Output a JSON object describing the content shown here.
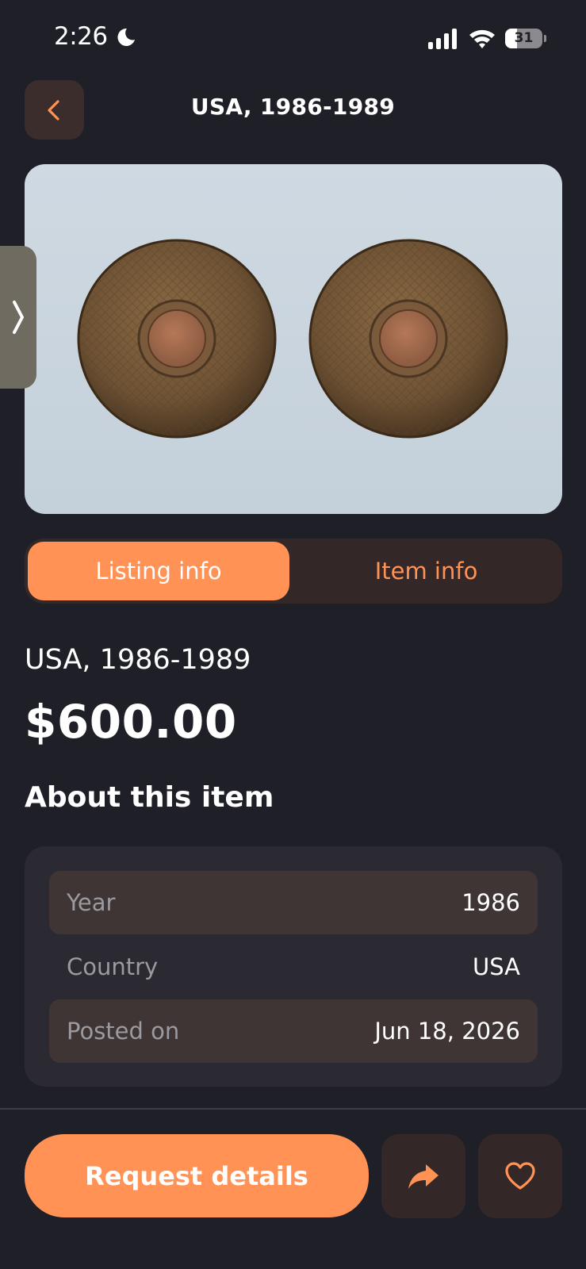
{
  "status_bar": {
    "time": "2:26",
    "battery_level": "31",
    "battery_fraction": 0.31,
    "icons": [
      "moon-icon",
      "signal-icon",
      "wifi-icon",
      "battery-icon"
    ]
  },
  "header": {
    "title": "USA, 1986-1989",
    "back_icon": "chevron-left-icon"
  },
  "image": {
    "handle_icon": "chevron-right-icon"
  },
  "tabs": [
    {
      "label": "Listing info",
      "active": true
    },
    {
      "label": "Item info",
      "active": false
    }
  ],
  "listing": {
    "name": "USA, 1986-1989",
    "price": "$600.00"
  },
  "about": {
    "heading": "About this item",
    "rows": [
      {
        "label": "Year",
        "value": "1986"
      },
      {
        "label": "Country",
        "value": "USA"
      },
      {
        "label": "Posted on",
        "value": "Jun 18, 2026"
      }
    ]
  },
  "actions": {
    "request_label": "Request details",
    "share_icon": "share-icon",
    "favorite_icon": "heart-icon"
  },
  "colors": {
    "background": "#1f1f27",
    "accent": "#ff9254",
    "surface": "#332727",
    "card": "#2b2a32"
  }
}
